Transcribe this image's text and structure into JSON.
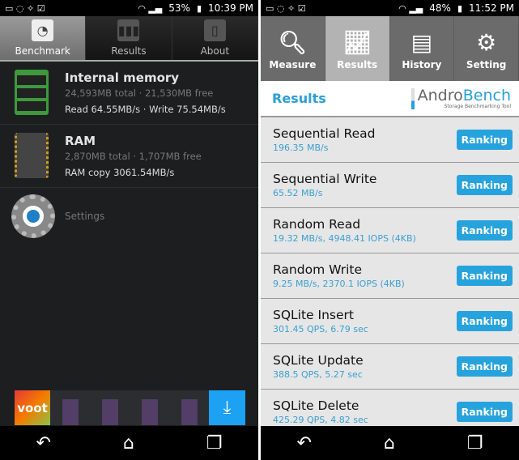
{
  "left": {
    "status": {
      "battery": "53%",
      "time": "10:39 PM"
    },
    "tabs": [
      {
        "label": "Benchmark",
        "active": true
      },
      {
        "label": "Results"
      },
      {
        "label": "About"
      }
    ],
    "items": [
      {
        "title": "Internal memory",
        "sub": "24,593MB total · 21,530MB free",
        "detail": "Read 64.55MB/s · Write 75.54MB/s"
      },
      {
        "title": "RAM",
        "sub": "2,870MB total · 1,707MB free",
        "detail": "RAM copy 3061.54MB/s"
      }
    ],
    "settings": "Settings",
    "ad": {
      "brand": "voot"
    }
  },
  "right": {
    "status": {
      "battery": "48%",
      "time": "11:52 PM"
    },
    "tabs": [
      {
        "label": "Measure"
      },
      {
        "label": "Results",
        "active": true
      },
      {
        "label": "History"
      },
      {
        "label": "Setting"
      }
    ],
    "header": "Results",
    "logo": {
      "a": "Andro",
      "b": "Bench",
      "tagline": "Storage Benchmarking Tool"
    },
    "button": "Ranking",
    "rows": [
      {
        "name": "Sequential Read",
        "value": "196.35 MB/s"
      },
      {
        "name": "Sequential Write",
        "value": "65.52 MB/s"
      },
      {
        "name": "Random Read",
        "value": "19.32 MB/s, 4948.41 IOPS (4KB)"
      },
      {
        "name": "Random Write",
        "value": "9.25 MB/s, 2370.1 IOPS (4KB)"
      },
      {
        "name": "SQLite Insert",
        "value": "301.45 QPS, 6.79 sec"
      },
      {
        "name": "SQLite Update",
        "value": "388.5 QPS, 5.27 sec"
      },
      {
        "name": "SQLite Delete",
        "value": "425.29 QPS, 4.82 sec"
      }
    ]
  },
  "colors": {
    "accent": "#26a3dd",
    "memory_chip": "#3c9a3c"
  }
}
